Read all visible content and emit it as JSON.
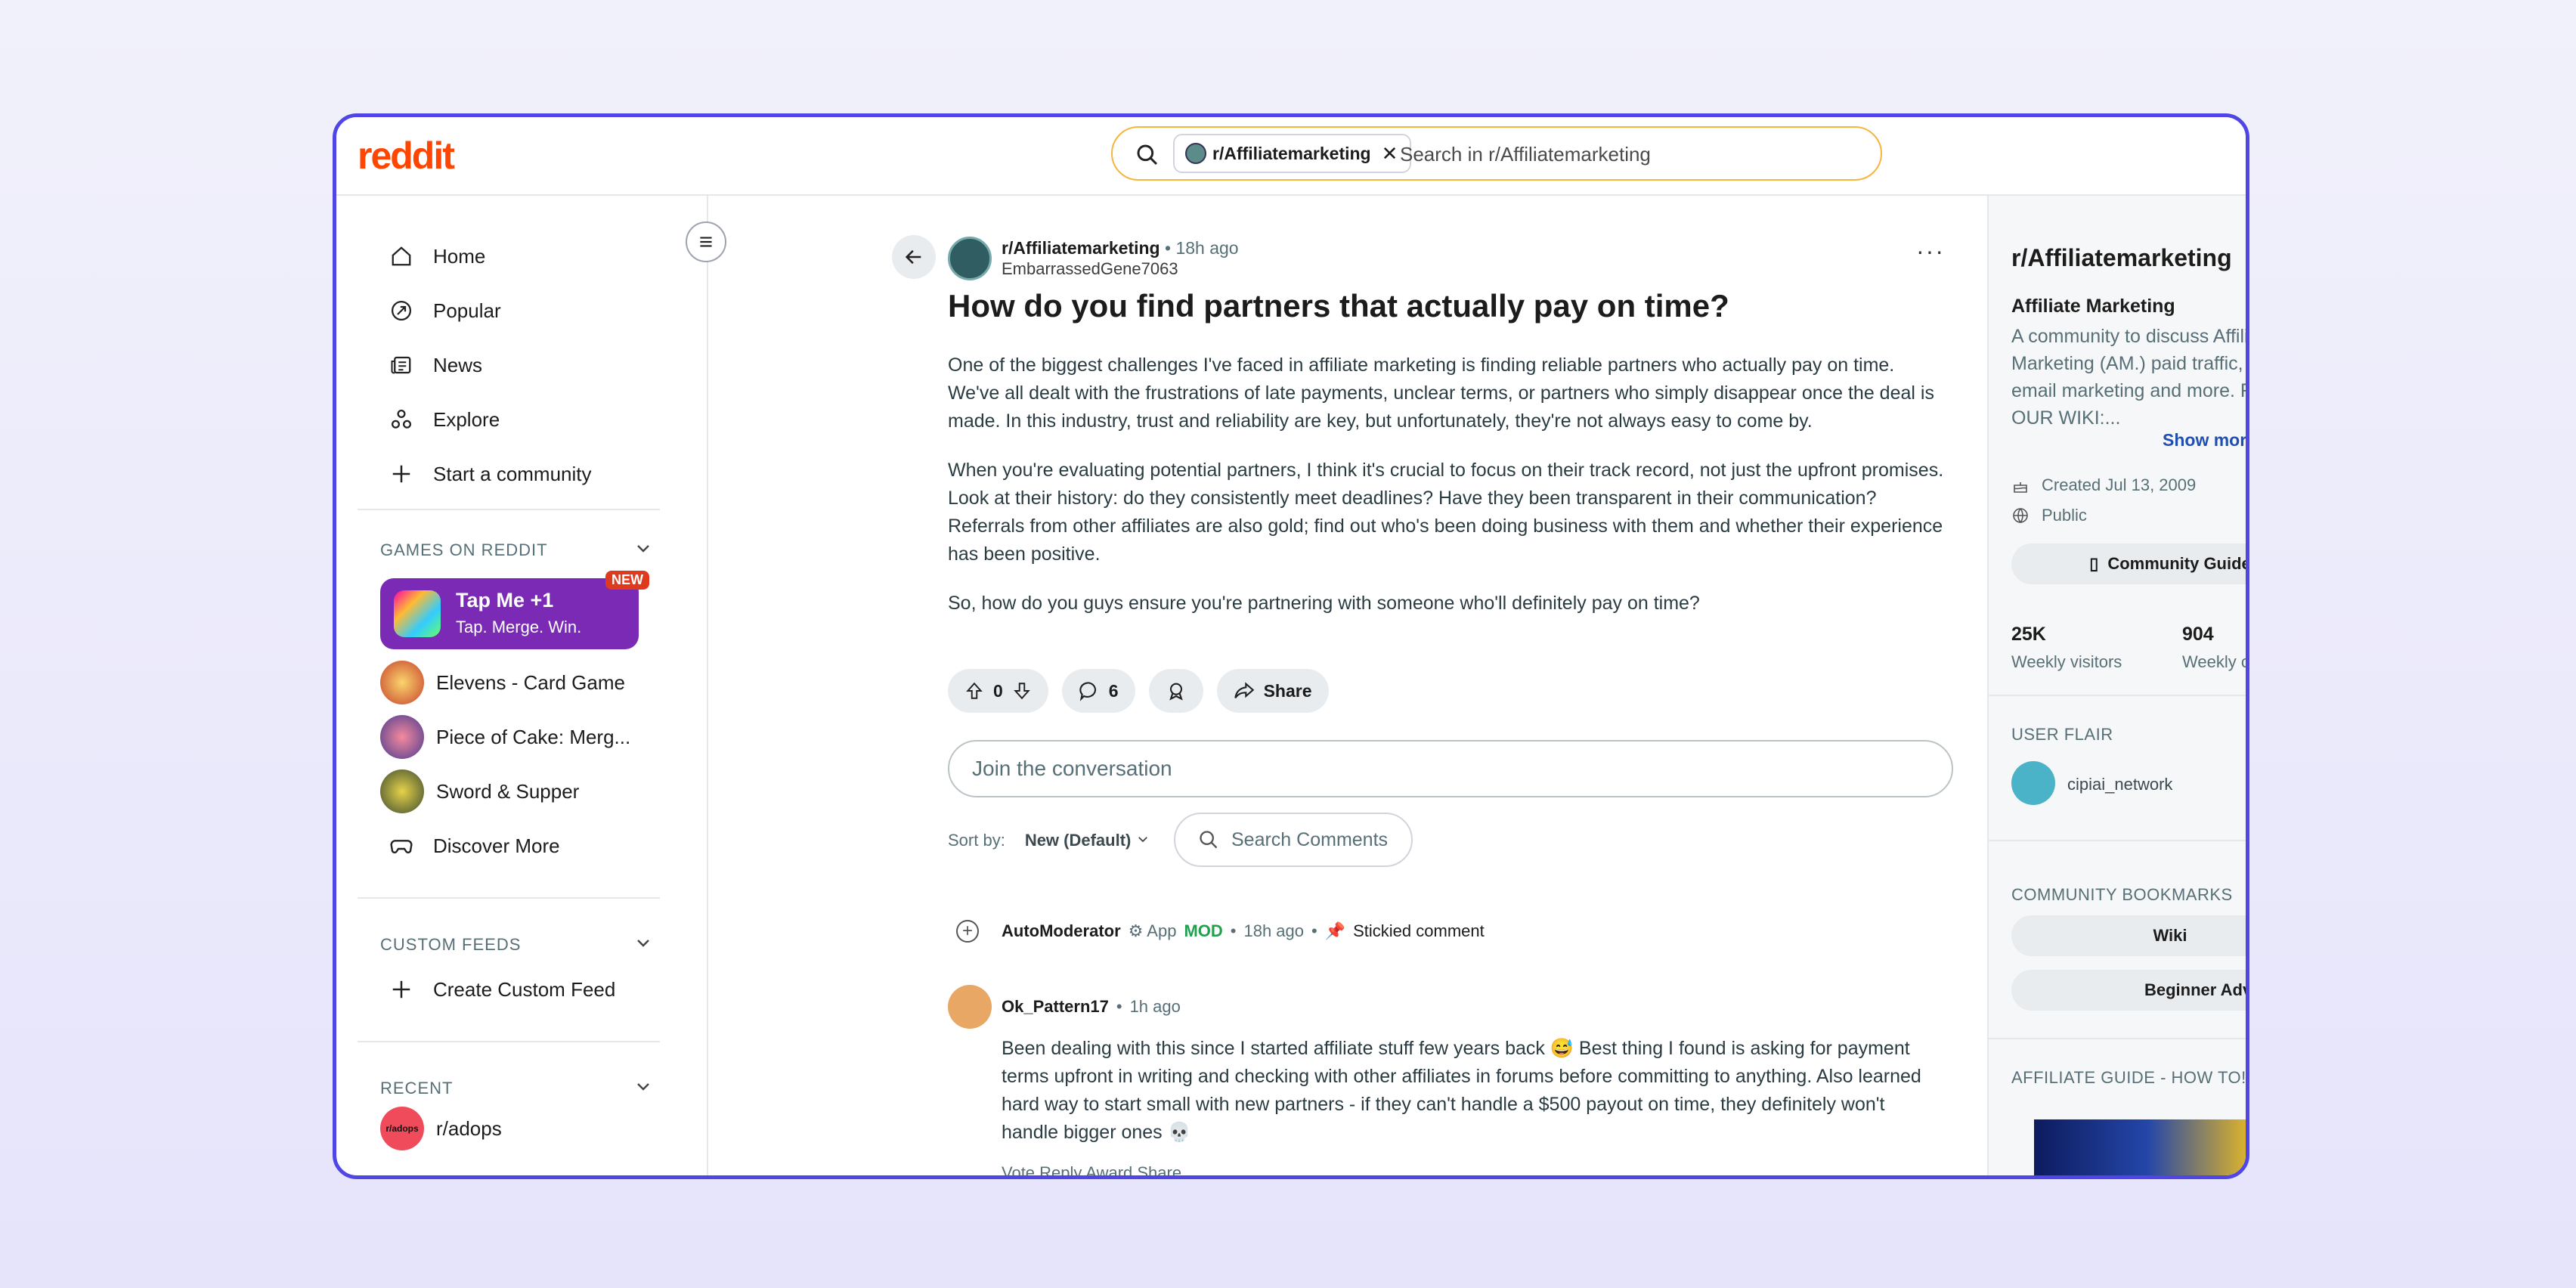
{
  "header": {
    "logo": "reddit",
    "search_chip": "r/Affiliatemarketing",
    "search_placeholder": "Search in r/Affiliatemarketing"
  },
  "left_nav": {
    "items": [
      {
        "label": "Home",
        "icon": "home-icon"
      },
      {
        "label": "Popular",
        "icon": "popular-icon"
      },
      {
        "label": "News",
        "icon": "news-icon"
      },
      {
        "label": "Explore",
        "icon": "explore-icon"
      },
      {
        "label": "Start a community",
        "icon": "plus-icon"
      }
    ],
    "games_header": "GAMES ON REDDIT",
    "featured_game": {
      "title": "Tap Me +1",
      "subtitle": "Tap. Merge. Win.",
      "badge": "NEW"
    },
    "games": [
      {
        "label": "Elevens - Card Game"
      },
      {
        "label": "Piece of Cake: Merg..."
      },
      {
        "label": "Sword & Supper"
      },
      {
        "label": "Discover More"
      }
    ],
    "custom_feeds_header": "CUSTOM FEEDS",
    "create_feed": "Create Custom Feed",
    "recent_header": "RECENT",
    "recent": [
      {
        "label": "r/adops",
        "avatar_text": "r/adops"
      }
    ]
  },
  "post": {
    "subreddit": "r/Affiliatemarketing",
    "time": "18h ago",
    "author": "EmbarrassedGene7063",
    "title": "How do you find partners that actually pay on time?",
    "paragraphs": [
      "One of the biggest challenges I've faced in affiliate marketing is finding reliable partners who actually pay on time. We've all dealt with the frustrations of late payments, unclear terms, or partners who simply disappear once the deal is made. In this industry, trust and reliability are key, but unfortunately, they're not always easy to come by.",
      "When you're evaluating potential partners, I think it's crucial to focus on their track record, not just the upfront promises. Look at their history: do they consistently meet deadlines? Have they been transparent in their communication? Referrals from other affiliates are also gold; find out who's been doing business with them and whether their experience has been positive.",
      "So, how do you guys ensure you're partnering with someone who'll definitely pay on time?"
    ],
    "votes": "0",
    "comments": "6",
    "share_label": "Share"
  },
  "comments_area": {
    "join_placeholder": "Join the conversation",
    "sort_label": "Sort by:",
    "sort_value": "New (Default)",
    "search_comments": "Search Comments",
    "automod": {
      "name": "AutoModerator",
      "app": "App",
      "mod": "MOD",
      "time": "18h ago",
      "stickied": "Stickied comment"
    },
    "comment": {
      "author": "Ok_Pattern17",
      "time": "1h ago",
      "text": "Been dealing with this since I started affiliate stuff few years back 😅 Best thing I found is asking for payment terms upfront in writing and checking with other affiliates in forums before committing to anything. Also learned hard way to start small with new partners - if they can't handle a $500 payout on time, they definitely won't handle bigger ones 💀",
      "actions": "Vote    Reply    Award    Share   ..."
    }
  },
  "sidebar": {
    "title": "r/Affiliatemarketing",
    "subtitle": "Affiliate Marketing",
    "description": "A community to discuss Affiliate Marketing (AM.) paid traffic, SEO, email marketing and more. READ OUR WIKI:...",
    "show_more": "Show more",
    "created": "Created Jul 13, 2009",
    "visibility": "Public",
    "guide_button": "Community Guide",
    "stats": [
      {
        "value": "25K",
        "label": "Weekly visitors"
      },
      {
        "value": "904",
        "label": "Weekly contributions"
      }
    ],
    "user_flair_header": "USER FLAIR",
    "user_flair_name": "cipiai_network",
    "bookmarks_header": "COMMUNITY BOOKMARKS",
    "bookmarks": [
      "Wiki",
      "Beginner Advice"
    ],
    "guide_header": "AFFILIATE GUIDE - HOW TO!"
  },
  "colors": {
    "accent": "#4f46e5",
    "brand": "#ff4500",
    "game_purple": "#7a2ab5",
    "mod_green": "#22a050"
  }
}
